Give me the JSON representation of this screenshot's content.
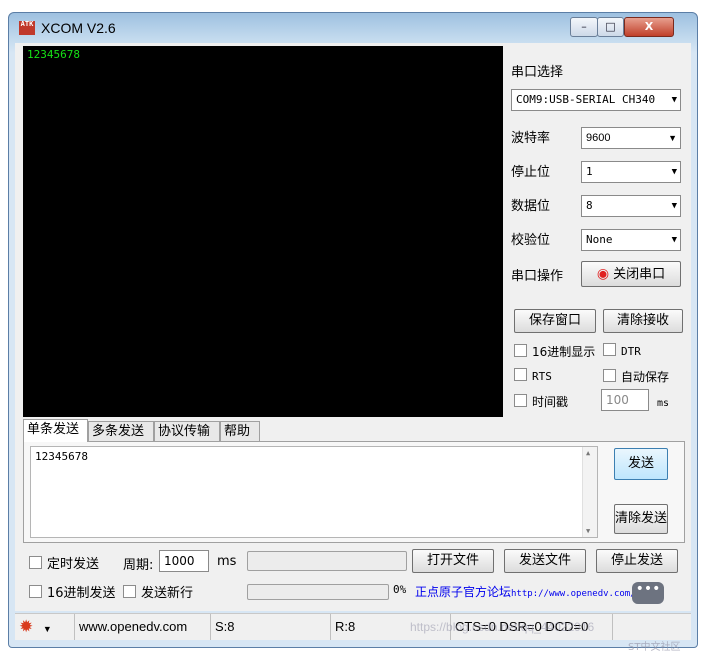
{
  "window": {
    "icon_text": "ATK",
    "title": "XCOM V2.6",
    "minimize_glyph": "–",
    "maximize_glyph": "□",
    "close_glyph": "X"
  },
  "receive": {
    "text": "12345678"
  },
  "serial": {
    "port_label": "串口选择",
    "port_value": "COM9:USB-SERIAL CH340",
    "baud_label": "波特率",
    "baud_value": "9600",
    "stop_label": "停止位",
    "stop_value": "1",
    "data_label": "数据位",
    "data_value": "8",
    "parity_label": "校验位",
    "parity_value": "None",
    "op_label": "串口操作",
    "op_button": "关闭串口",
    "save_window": "保存窗口",
    "clear_receive": "清除接收",
    "hex_display": "16进制显示",
    "dtr": "DTR",
    "rts": "RTS",
    "auto_save": "自动保存",
    "timestamp": "时间戳",
    "timestamp_value": "100",
    "timestamp_unit": "ms"
  },
  "tabs": [
    "单条发送",
    "多条发送",
    "协议传输",
    "帮助"
  ],
  "send": {
    "text": "12345678",
    "send_button": "发送",
    "clear_send_button": "清除发送",
    "timed_send": "定时发送",
    "period_label": "周期:",
    "period_value": "1000",
    "period_unit": "ms",
    "open_file": "打开文件",
    "send_file": "发送文件",
    "stop_send": "停止发送",
    "hex_send": "16进制发送",
    "send_newline": "发送新行",
    "progress_text": "0%",
    "progress_value": 0,
    "forum_link_text": "正点原子官方论坛",
    "forum_link_url": "http://www.openedv.com/"
  },
  "statusbar": {
    "website": "www.openedv.com",
    "sent": "S:8",
    "received": "R:8",
    "signals": "CTS=0 DSR=0 DCD=0"
  },
  "overlay": {
    "watermark": "https://blog.csdn.net/qq_44022916",
    "watermark_small": "ST中文社区"
  }
}
